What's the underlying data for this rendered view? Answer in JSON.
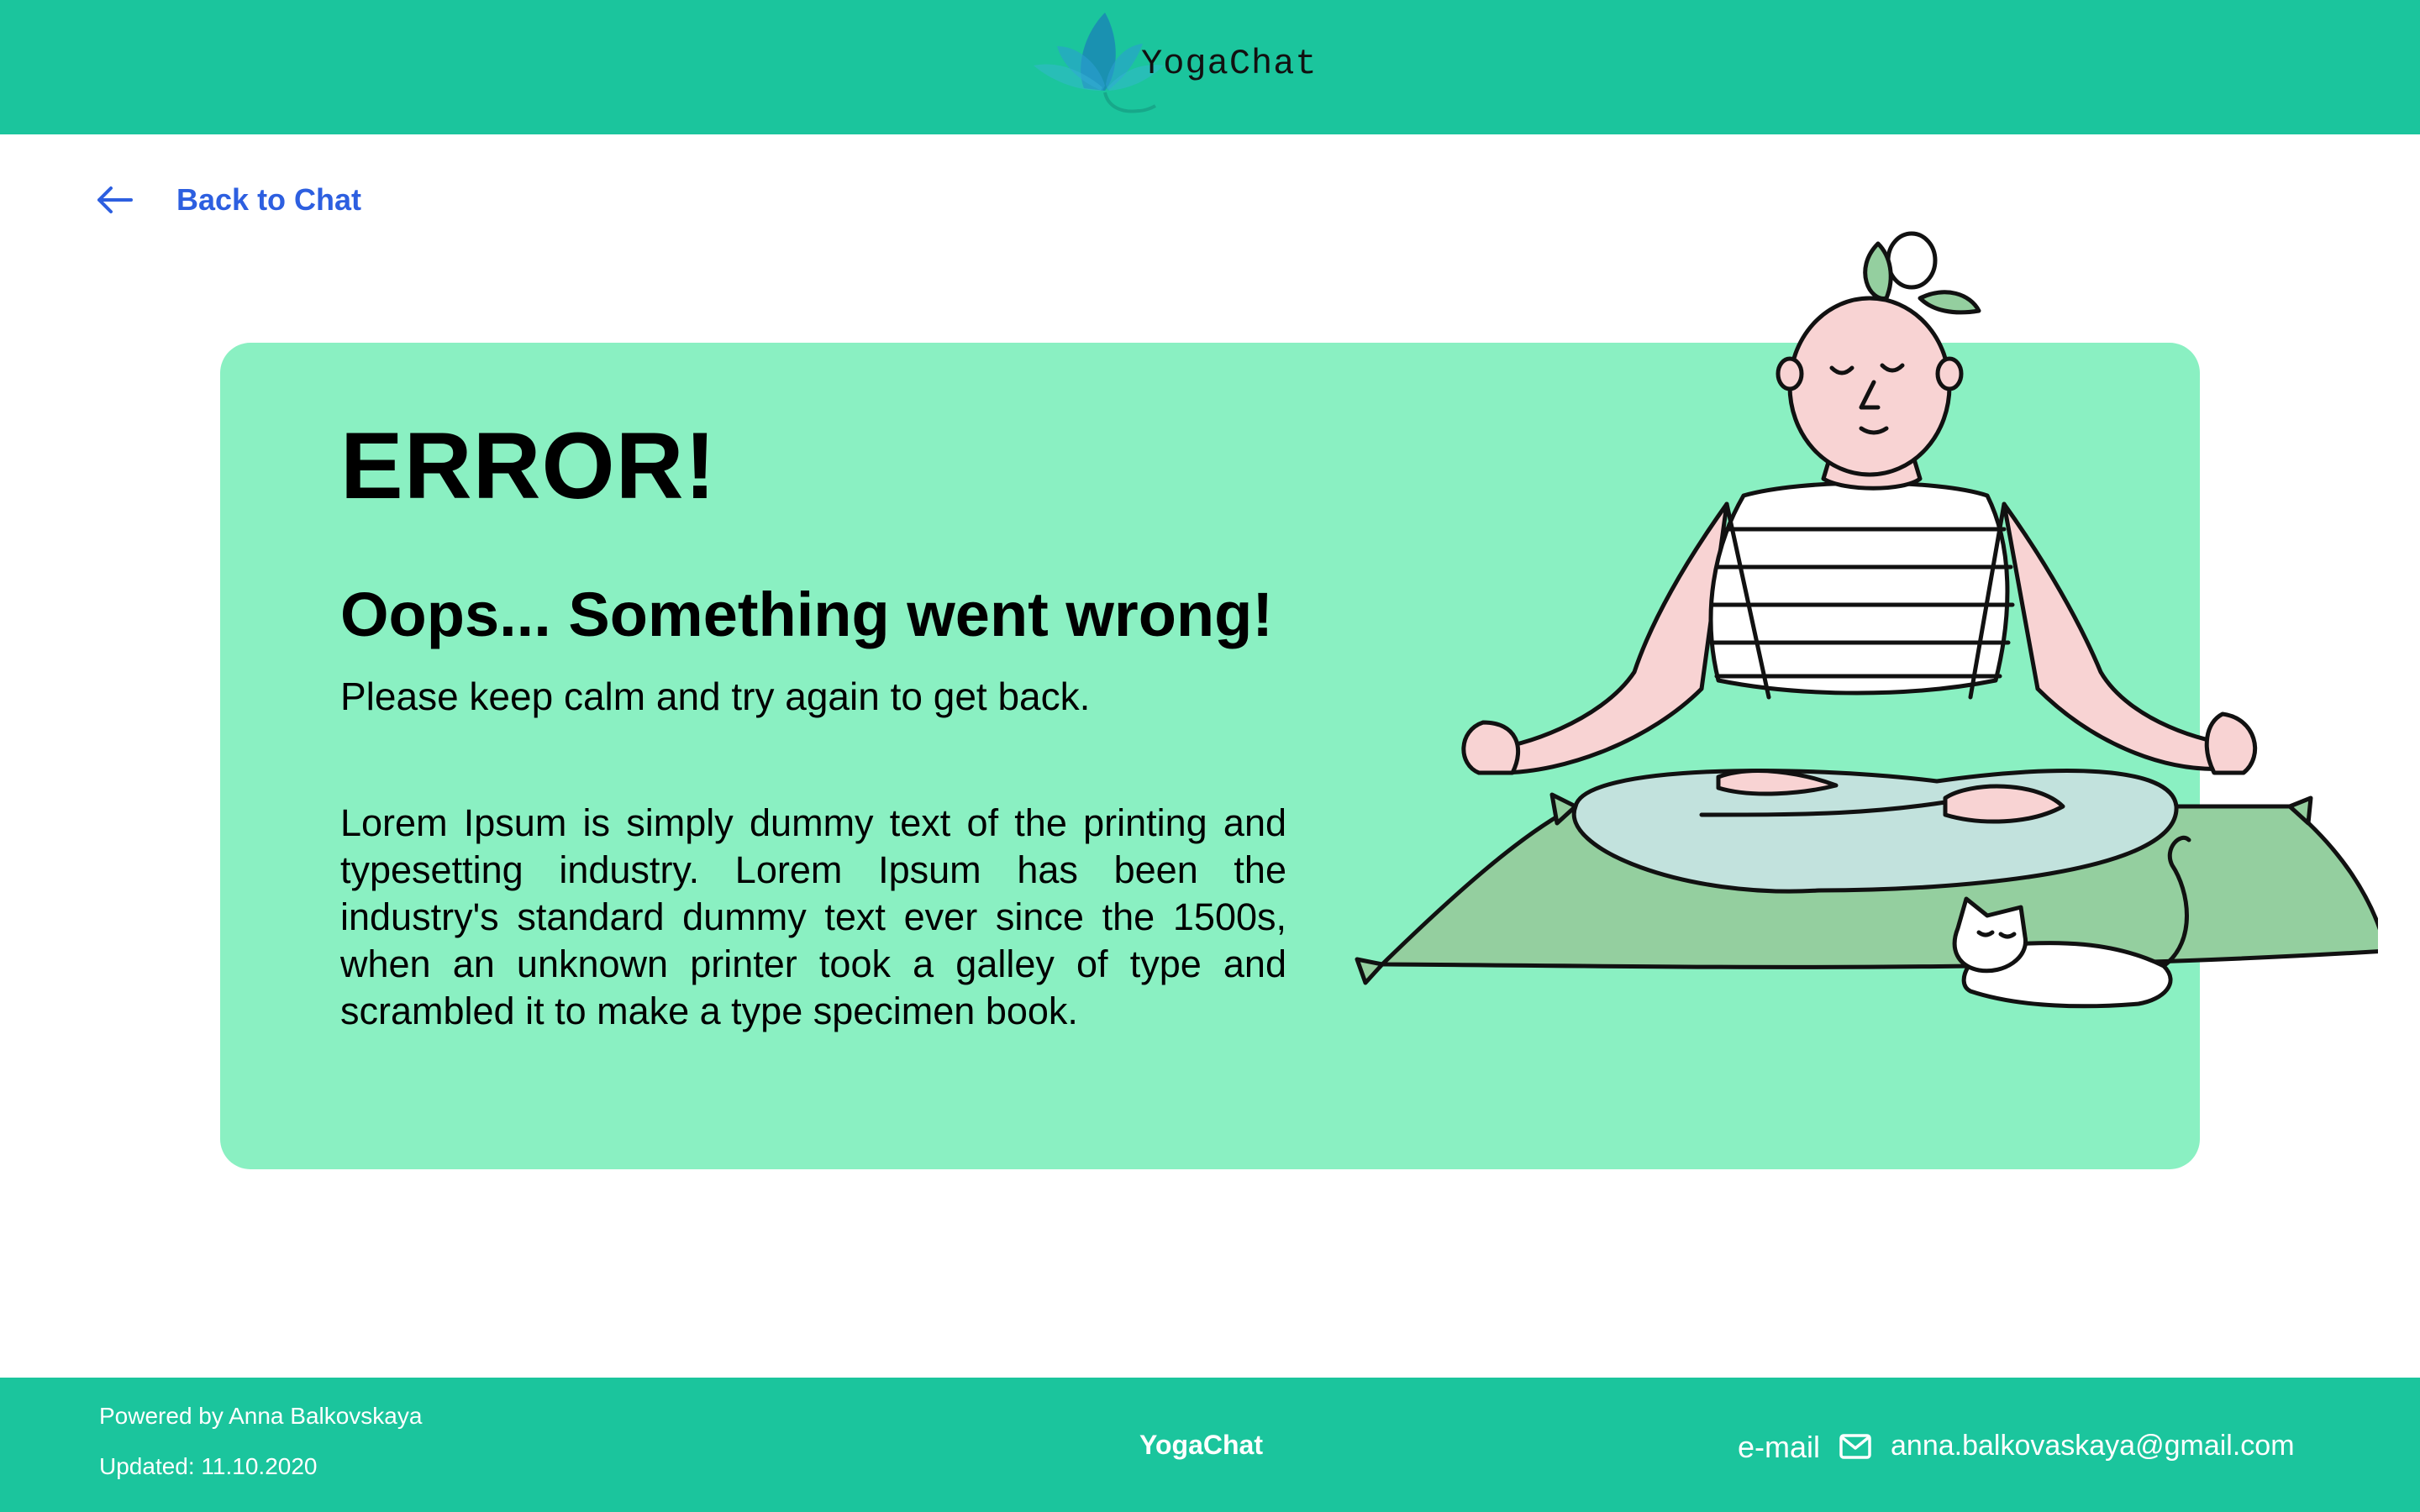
{
  "header": {
    "brand": "YogaChat"
  },
  "nav": {
    "back_label": "Back to Chat"
  },
  "error": {
    "title": "ERROR!",
    "subtitle": "Oops... Something went wrong!",
    "note": "Please keep calm and try again to get back.",
    "body": "Lorem Ipsum is simply dummy text of the printing and typesetting industry. Lorem Ipsum has been the industry's standard dummy text ever since the 1500s, when an unknown printer took a galley of type and scrambled it to make a type specimen book."
  },
  "footer": {
    "powered_by": "Powered by Anna Balkovskaya",
    "updated": "Updated: 11.10.2020",
    "brand": "YogaChat",
    "email_label": "e-mail",
    "email": "anna.balkovaskaya@gmail.com"
  },
  "icons": {
    "logo": "lotus-icon",
    "back": "arrow-left-icon",
    "mail": "mail-icon"
  },
  "colors": {
    "header_bg": "#1bc59d",
    "card_bg": "#8af0c2",
    "link": "#2d5fe0",
    "mat": "#94cf9f",
    "legs": "#c2e2dd",
    "skin": "#f8d3d3"
  }
}
